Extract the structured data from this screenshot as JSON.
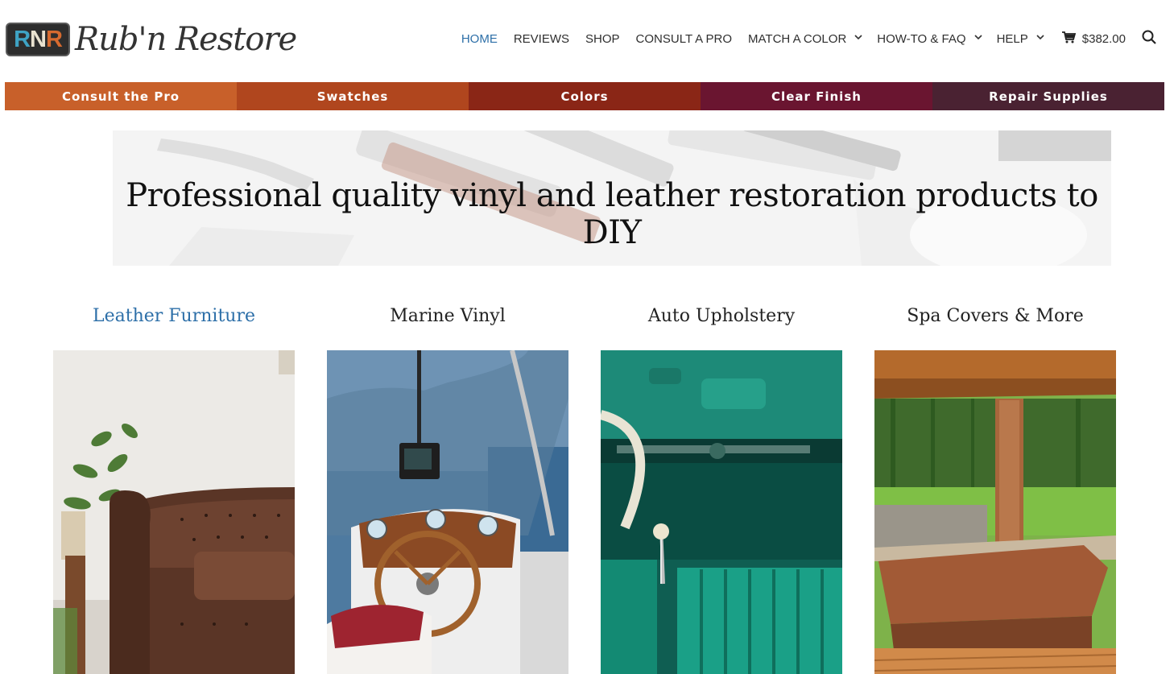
{
  "logo": {
    "badge": "RNR",
    "wordmark": "Rub'n Restore"
  },
  "nav": {
    "items": [
      {
        "label": "HOME",
        "active": true,
        "dropdown": false
      },
      {
        "label": "REVIEWS",
        "active": false,
        "dropdown": false
      },
      {
        "label": "SHOP",
        "active": false,
        "dropdown": false
      },
      {
        "label": "CONSULT A PRO",
        "active": false,
        "dropdown": false
      },
      {
        "label": "MATCH A COLOR",
        "active": false,
        "dropdown": true
      },
      {
        "label": "HOW-TO & FAQ",
        "active": false,
        "dropdown": true
      },
      {
        "label": "HELP",
        "active": false,
        "dropdown": true
      }
    ],
    "cart_total": "$382.00",
    "cart_icon": "shopping-cart-icon",
    "search_icon": "search-icon"
  },
  "category_bar": [
    {
      "label": "Consult the Pro",
      "color": "#c8602a"
    },
    {
      "label": "Swatches",
      "color": "#b0461e"
    },
    {
      "label": "Colors",
      "color": "#8a2616"
    },
    {
      "label": "Clear Finish",
      "color": "#6a1530"
    },
    {
      "label": "Repair Supplies",
      "color": "#4a2232"
    }
  ],
  "hero": {
    "headline": "Professional quality vinyl and leather restoration products to DIY"
  },
  "categories": [
    {
      "title": "Leather Furniture",
      "active": true
    },
    {
      "title": "Marine Vinyl",
      "active": false
    },
    {
      "title": "Auto Upholstery",
      "active": false
    },
    {
      "title": "Spa Covers & More",
      "active": false
    }
  ],
  "colors": {
    "accent": "#2d6fa8",
    "text": "#2f2f2f"
  }
}
